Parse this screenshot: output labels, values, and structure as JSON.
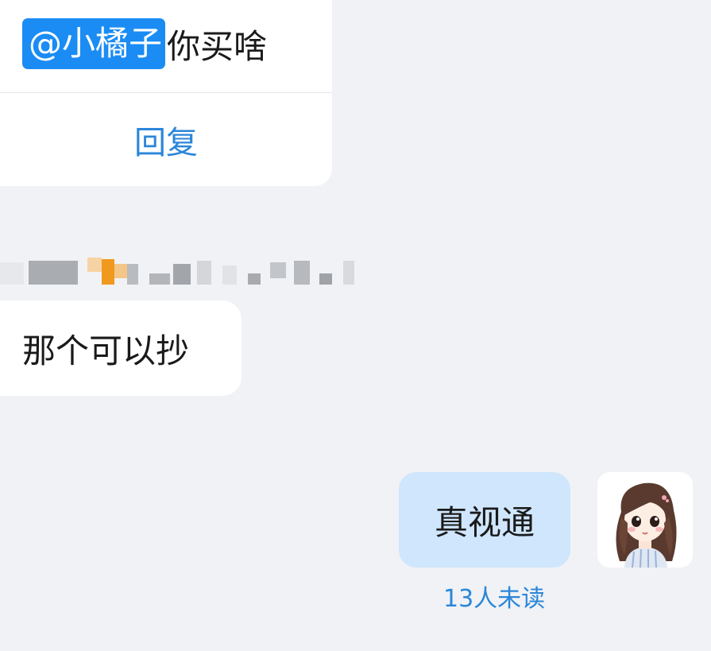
{
  "top_message": {
    "mention": "@小橘子",
    "text": "你买啥",
    "reply_label": "回复"
  },
  "message_in": {
    "sender": "",
    "text": "那个可以抄"
  },
  "message_out": {
    "text": "真视通",
    "unread_status": "13人未读",
    "avatar_icon": "cartoon-girl-avatar"
  },
  "colors": {
    "background": "#f0f2f5",
    "mention_bg": "#1a8cf4",
    "link": "#2b86d9",
    "outgoing_bubble": "#cfe6fd"
  }
}
